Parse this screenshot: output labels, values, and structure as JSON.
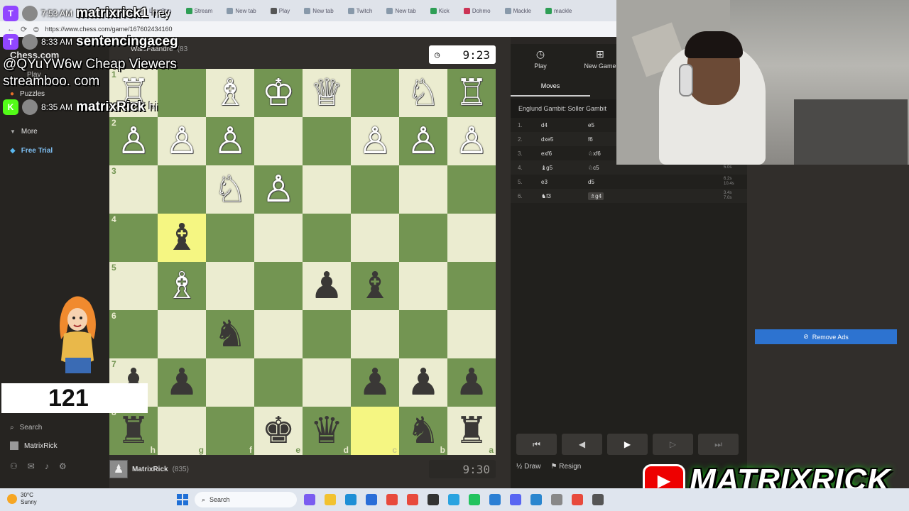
{
  "browser": {
    "tabs": [
      {
        "label": "Live Stre",
        "color": "#bbbbbb"
      },
      {
        "label": "Stream",
        "color": "#2e9e55"
      },
      {
        "label": "New tab",
        "color": "#8899aa"
      },
      {
        "label": "Play",
        "color": "#555555"
      },
      {
        "label": "New tab",
        "color": "#8899aa"
      },
      {
        "label": "Twitch",
        "color": "#8899aa"
      },
      {
        "label": "New tab",
        "color": "#8899aa"
      },
      {
        "label": "Kick",
        "color": "#2e9e55"
      },
      {
        "label": "Dohmo",
        "color": "#cc3355"
      },
      {
        "label": "Mackle",
        "color": "#8899aa"
      },
      {
        "label": "mackle",
        "color": "#2e9e55"
      }
    ],
    "url": "https://www.chess.com/game/167602434160"
  },
  "sidebar": {
    "logo": "Chess.com",
    "play": "Play",
    "puzzles": "Puzzles",
    "more": "More",
    "free_trial": "Free Trial",
    "search": "Search",
    "username": "MatrixRick"
  },
  "game": {
    "top_player": {
      "name": "WaniFaandre",
      "rating": "(83"
    },
    "bottom_player": {
      "name": "MatrixRick",
      "rating": "(835)"
    },
    "top_clock": "9:23",
    "bottom_clock": "9:30",
    "board": {
      "rank_labels": [
        "1",
        "2",
        "3",
        "4",
        "5",
        "6",
        "7",
        "8"
      ],
      "file_labels": [
        "h",
        "g",
        "f",
        "e",
        "d",
        "c",
        "b",
        "a"
      ],
      "rows": [
        [
          "wR",
          "",
          "wB",
          "wK",
          "wQ",
          "",
          "wN",
          "wR"
        ],
        [
          "wP",
          "wP",
          "wP",
          "",
          "",
          "wP",
          "wP",
          "wP"
        ],
        [
          "",
          "",
          "wN",
          "wP",
          "",
          "",
          "",
          ""
        ],
        [
          "",
          "bB",
          "",
          "",
          "",
          "",
          "",
          ""
        ],
        [
          "",
          "wB",
          "",
          "",
          "bP",
          "bB",
          "",
          ""
        ],
        [
          "",
          "",
          "bN",
          "",
          "",
          "",
          "",
          ""
        ],
        [
          "bP",
          "bP",
          "",
          "",
          "",
          "bP",
          "bP",
          "bP"
        ],
        [
          "bR",
          "",
          "",
          "bK",
          "bQ",
          "",
          "bN",
          "bR"
        ]
      ],
      "highlights": [
        [
          3,
          1
        ],
        [
          7,
          5
        ]
      ]
    }
  },
  "panel": {
    "play_label": "Play",
    "new_game_label": "New Game",
    "moves_tab": "Moves",
    "opening": "Englund Gambit: Soller Gambit",
    "moves": [
      {
        "num": "1.",
        "white": "d4",
        "black": "e5",
        "t1": "",
        "t2": ""
      },
      {
        "num": "2.",
        "white": "dxe5",
        "black": "f6",
        "t1": "",
        "t2": ""
      },
      {
        "num": "3.",
        "white": "exf6",
        "black": "♘xf6",
        "t1": "",
        "t2": ""
      },
      {
        "num": "4.",
        "white": "♝g5",
        "black": "♘c5",
        "t1": "5.0s",
        "t2": ""
      },
      {
        "num": "5.",
        "white": "e3",
        "black": "d5",
        "t1": "6.2s",
        "t2": "10.4s"
      },
      {
        "num": "6.",
        "white": "♞f3",
        "black": "♗g4",
        "t1": "3.4s",
        "t2": "7.0s"
      }
    ],
    "draw": "Draw",
    "resign": "Resign",
    "remove_ads": "Remove Ads"
  },
  "overlay": {
    "chat": [
      {
        "time": "7:53 AM",
        "user": "matrixrick1",
        "msg": "hey",
        "icon_color": "#9146ff",
        "icon": "T"
      },
      {
        "time": "8:33 AM",
        "user": "sentencingaceg",
        "msg": "",
        "icon_color": "#9146ff",
        "icon": "T"
      },
      {
        "time": "8:35 AM",
        "user": "matrixRick",
        "msg": "hi",
        "icon_color": "#53fc18",
        "icon": "K"
      }
    ],
    "promo_line1": "@QYuYW6w Cheap Viewers",
    "promo_line2": "streamboo. com",
    "counter": "121",
    "logo": "MATRIXRICK"
  },
  "taskbar": {
    "temperature": "30°C",
    "condition": "Sunny",
    "search": "Search"
  }
}
